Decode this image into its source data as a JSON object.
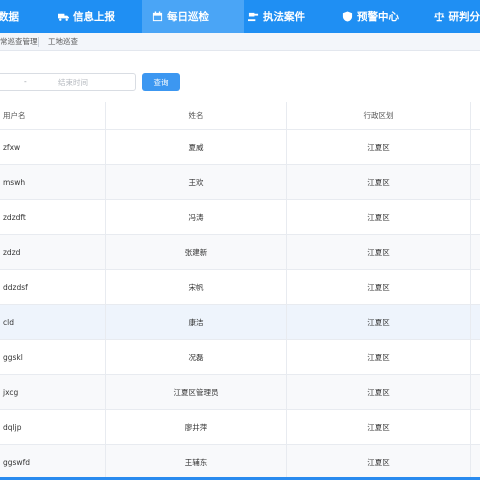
{
  "nav": [
    {
      "label": "数据",
      "icon": "none"
    },
    {
      "label": "信息上报",
      "icon": "truck-icon"
    },
    {
      "label": "每日巡检",
      "icon": "calendar-icon"
    },
    {
      "label": "执法案件",
      "icon": "gavel-icon"
    },
    {
      "label": "预警中心",
      "icon": "shield-icon"
    },
    {
      "label": "研判分",
      "icon": "scale-icon"
    }
  ],
  "nav_active_index": 2,
  "breadcrumb": [
    "常巡查管理",
    "工地巡查"
  ],
  "filter": {
    "date_dash": "-",
    "end_placeholder": "结束时间",
    "query_button": "查询"
  },
  "table": {
    "columns": [
      "用户名",
      "姓名",
      "行政区划"
    ],
    "rows": [
      {
        "username": "zfxw",
        "name": "夏威",
        "region": "江夏区"
      },
      {
        "username": "mswh",
        "name": "王欢",
        "region": "江夏区"
      },
      {
        "username": "zdzdft",
        "name": "冯涛",
        "region": "江夏区"
      },
      {
        "username": "zdzd",
        "name": "张建新",
        "region": "江夏区"
      },
      {
        "username": "ddzdsf",
        "name": "宋帆",
        "region": "江夏区"
      },
      {
        "username": "cld",
        "name": "康洁",
        "region": "江夏区"
      },
      {
        "username": "ggskl",
        "name": "况磊",
        "region": "江夏区"
      },
      {
        "username": "jxcg",
        "name": "江夏区管理员",
        "region": "江夏区"
      },
      {
        "username": "dqljp",
        "name": "廖井萍",
        "region": "江夏区"
      },
      {
        "username": "ggswfd",
        "name": "王辅东",
        "region": "江夏区"
      }
    ]
  },
  "colors": {
    "nav_bg": "#1f8ff3",
    "nav_active": "#4aa5f6",
    "button": "#3c97f1"
  }
}
